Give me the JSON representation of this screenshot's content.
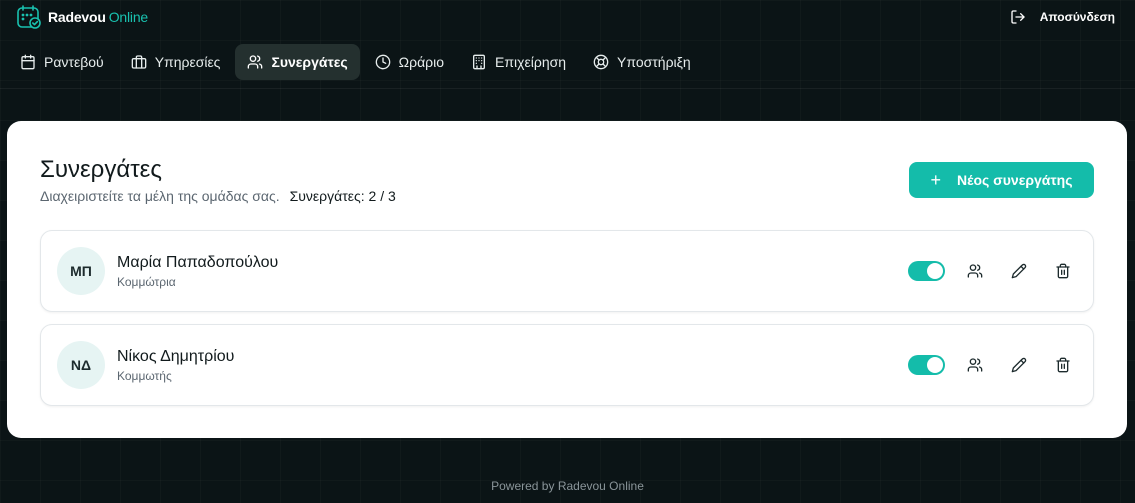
{
  "brand": {
    "name": "Radevou",
    "accent": "Online",
    "accent_color": "#19c2b0",
    "icon": "calendar-check-icon"
  },
  "header": {
    "logout_label": "Αποσύνδεση",
    "logout_icon": "logout-icon"
  },
  "nav": {
    "items": [
      {
        "label": "Ραντεβού",
        "icon": "calendar-icon",
        "active": false
      },
      {
        "label": "Υπηρεσίες",
        "icon": "briefcase-icon",
        "active": false
      },
      {
        "label": "Συνεργάτες",
        "icon": "users-icon",
        "active": true
      },
      {
        "label": "Ωράριο",
        "icon": "clock-icon",
        "active": false
      },
      {
        "label": "Επιχείρηση",
        "icon": "building-icon",
        "active": false
      },
      {
        "label": "Υποστήριξη",
        "icon": "lifebuoy-icon",
        "active": false
      }
    ]
  },
  "page": {
    "title": "Συνεργάτες",
    "subtitle": "Διαχειριστείτε τα μέλη της ομάδας σας.",
    "count_label": "Συνεργάτες: 2 / 3",
    "new_button_label": "Νέος συνεργάτης",
    "new_button_color": "#14bcaa"
  },
  "members": [
    {
      "initials": "ΜΠ",
      "name": "Μαρία Παπαδοπούλου",
      "role": "Κομμώτρια",
      "active": true
    },
    {
      "initials": "ΝΔ",
      "name": "Νίκος Δημητρίου",
      "role": "Κομμωτής",
      "active": true
    }
  ],
  "footer": {
    "text": "Powered by Radevou Online"
  }
}
